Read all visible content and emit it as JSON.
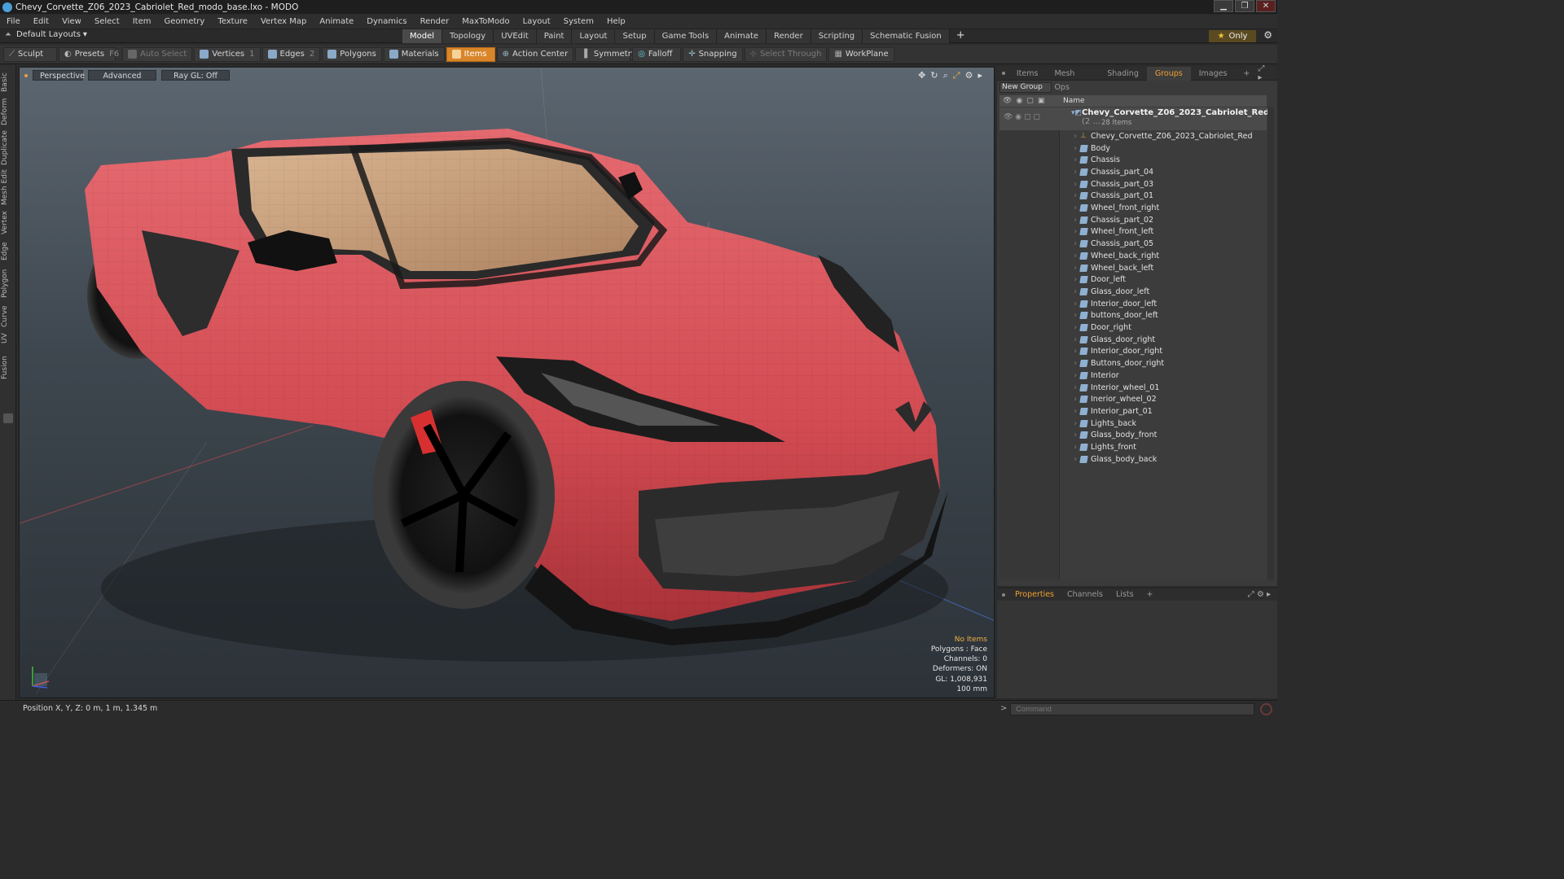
{
  "window": {
    "title": "Chevy_Corvette_Z06_2023_Cabriolet_Red_modo_base.lxo - MODO",
    "controls": [
      "▁",
      "❐",
      "✕"
    ]
  },
  "menu": [
    "File",
    "Edit",
    "View",
    "Select",
    "Item",
    "Geometry",
    "Texture",
    "Vertex Map",
    "Animate",
    "Dynamics",
    "Render",
    "MaxToModo",
    "Layout",
    "System",
    "Help"
  ],
  "layout": {
    "selector": "Default Layouts",
    "tabs": [
      "Model",
      "Topology",
      "UVEdit",
      "Paint",
      "Layout",
      "Setup",
      "Game Tools",
      "Animate",
      "Render",
      "Scripting",
      "Schematic Fusion"
    ],
    "active_tab": "Model",
    "only_label": "Only"
  },
  "toolbar": {
    "sculpt": "Sculpt",
    "presets": "Presets",
    "presets_key": "F6",
    "auto_select": "Auto Select",
    "vertices": "Vertices",
    "vertices_key": "1",
    "edges": "Edges",
    "edges_key": "2",
    "polygons": "Polygons",
    "materials": "Materials",
    "items": "Items",
    "action_center": "Action Center",
    "symmetry": "Symmetry",
    "falloff": "Falloff",
    "snapping": "Snapping",
    "select_through": "Select Through",
    "workplane": "WorkPlane"
  },
  "left_tools": [
    "Basic",
    "Deform",
    "Duplicate",
    "Mesh Edit",
    "Vertex",
    "Edge",
    "Polygon",
    "Curve",
    "UV",
    "Fusion"
  ],
  "viewport": {
    "view": "Perspective",
    "shading": "Advanced",
    "raygl": "Ray GL: Off",
    "stats": {
      "items": "No Items",
      "polygons": "Polygons : Face",
      "channels": "Channels: 0",
      "deformers": "Deformers: ON",
      "gl": "GL: 1,008,931",
      "scale": "100 mm"
    }
  },
  "right_panel": {
    "tabs": [
      "Items",
      "Mesh Ops",
      "Shading",
      "Groups",
      "Images"
    ],
    "active_tab": "Groups",
    "new_group": "New Group",
    "name_header": "Name",
    "root": {
      "name": "Chevy_Corvette_Z06_2023_Cabriolet_Red",
      "suffix": "(2 ...",
      "count": "28 Items"
    },
    "items": [
      "Chevy_Corvette_Z06_2023_Cabriolet_Red",
      "Body",
      "Chassis",
      "Chassis_part_04",
      "Chassis_part_03",
      "Chassis_part_01",
      "Wheel_front_right",
      "Chassis_part_02",
      "Wheel_front_left",
      "Chassis_part_05",
      "Wheel_back_right",
      "Wheel_back_left",
      "Door_left",
      "Glass_door_left",
      "Interior_door_left",
      "buttons_door_left",
      "Door_right",
      "Glass_door_right",
      "Interior_door_right",
      "Buttons_door_right",
      "Interior",
      "Interior_wheel_01",
      "Inerior_wheel_02",
      "Interior_part_01",
      "Lights_back",
      "Glass_body_front",
      "Lights_front",
      "Glass_body_back"
    ]
  },
  "lower_panel": {
    "tabs": [
      "Properties",
      "Channels",
      "Lists"
    ],
    "active_tab": "Properties"
  },
  "status": {
    "position": "Position X, Y, Z:  0 m, 1 m, 1.345 m",
    "command_placeholder": "Command"
  },
  "colors": {
    "accent": "#f0a030",
    "car_body": "#d9535a",
    "viewport_top": "#5c6670",
    "viewport_bottom": "#2c3238"
  }
}
